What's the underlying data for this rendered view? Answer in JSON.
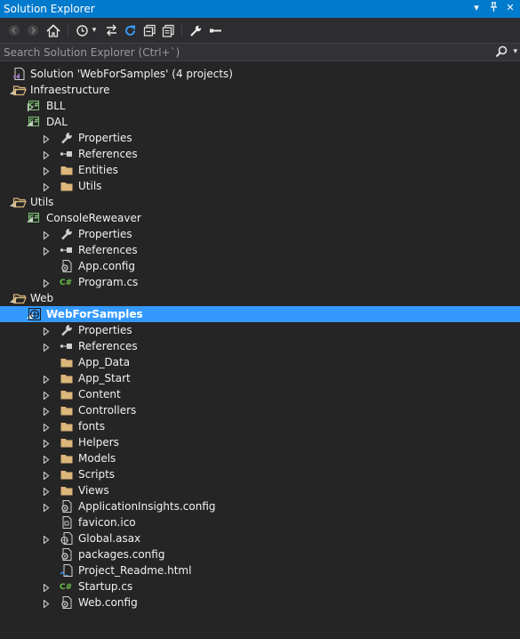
{
  "window": {
    "title": "Solution Explorer"
  },
  "search": {
    "placeholder": "Search Solution Explorer (Ctrl+`)"
  },
  "toolbar": {
    "buttons": [
      "back-icon",
      "forward-icon",
      "home-icon",
      "history-icon",
      "dropdown-icon",
      "sync-icon",
      "refresh-icon",
      "collapse-all-icon",
      "show-all-files-icon",
      "properties-icon",
      "preview-icon"
    ]
  },
  "tree": [
    {
      "label": "Solution 'WebForSamples' (4 projects)",
      "icon": "solution",
      "indent": 0,
      "expander": "none"
    },
    {
      "label": "Infraestructure",
      "icon": "folder-open",
      "indent": 0,
      "expander": "expanded"
    },
    {
      "label": "BLL",
      "icon": "csproj",
      "indent": 1,
      "expander": "collapsed"
    },
    {
      "label": "DAL",
      "icon": "csproj",
      "indent": 1,
      "expander": "expanded"
    },
    {
      "label": "Properties",
      "icon": "wrench",
      "indent": 2,
      "expander": "collapsed"
    },
    {
      "label": "References",
      "icon": "references",
      "indent": 2,
      "expander": "collapsed"
    },
    {
      "label": "Entities",
      "icon": "folder",
      "indent": 2,
      "expander": "collapsed"
    },
    {
      "label": "Utils",
      "icon": "folder",
      "indent": 2,
      "expander": "collapsed"
    },
    {
      "label": "Utils",
      "icon": "folder-open",
      "indent": 0,
      "expander": "expanded"
    },
    {
      "label": "ConsoleReweaver",
      "icon": "csproj",
      "indent": 1,
      "expander": "expanded"
    },
    {
      "label": "Properties",
      "icon": "wrench",
      "indent": 2,
      "expander": "collapsed"
    },
    {
      "label": "References",
      "icon": "references",
      "indent": 2,
      "expander": "collapsed"
    },
    {
      "label": "App.config",
      "icon": "config",
      "indent": 2,
      "expander": "none"
    },
    {
      "label": "Program.cs",
      "icon": "csfile",
      "indent": 2,
      "expander": "collapsed"
    },
    {
      "label": "Web",
      "icon": "folder-open",
      "indent": 0,
      "expander": "expanded"
    },
    {
      "label": "WebForSamples",
      "icon": "webproj",
      "indent": 1,
      "expander": "expanded",
      "selected": true
    },
    {
      "label": "Properties",
      "icon": "wrench",
      "indent": 2,
      "expander": "collapsed"
    },
    {
      "label": "References",
      "icon": "references",
      "indent": 2,
      "expander": "collapsed"
    },
    {
      "label": "App_Data",
      "icon": "folder",
      "indent": 2,
      "expander": "none"
    },
    {
      "label": "App_Start",
      "icon": "folder",
      "indent": 2,
      "expander": "collapsed"
    },
    {
      "label": "Content",
      "icon": "folder",
      "indent": 2,
      "expander": "collapsed"
    },
    {
      "label": "Controllers",
      "icon": "folder",
      "indent": 2,
      "expander": "collapsed"
    },
    {
      "label": "fonts",
      "icon": "folder",
      "indent": 2,
      "expander": "collapsed"
    },
    {
      "label": "Helpers",
      "icon": "folder",
      "indent": 2,
      "expander": "collapsed"
    },
    {
      "label": "Models",
      "icon": "folder",
      "indent": 2,
      "expander": "collapsed"
    },
    {
      "label": "Scripts",
      "icon": "folder",
      "indent": 2,
      "expander": "collapsed"
    },
    {
      "label": "Views",
      "icon": "folder",
      "indent": 2,
      "expander": "collapsed"
    },
    {
      "label": "ApplicationInsights.config",
      "icon": "config",
      "indent": 2,
      "expander": "collapsed"
    },
    {
      "label": "favicon.ico",
      "icon": "icofile",
      "indent": 2,
      "expander": "none"
    },
    {
      "label": "Global.asax",
      "icon": "asax",
      "indent": 2,
      "expander": "collapsed"
    },
    {
      "label": "packages.config",
      "icon": "config",
      "indent": 2,
      "expander": "none"
    },
    {
      "label": "Project_Readme.html",
      "icon": "html",
      "indent": 2,
      "expander": "none"
    },
    {
      "label": "Startup.cs",
      "icon": "csfile",
      "indent": 2,
      "expander": "collapsed"
    },
    {
      "label": "Web.config",
      "icon": "config",
      "indent": 2,
      "expander": "collapsed"
    }
  ],
  "colors": {
    "accent": "#007acc",
    "selection": "#3399ff",
    "background": "#252526",
    "folder": "#dcb67a",
    "csharp": "#6cbf48"
  }
}
